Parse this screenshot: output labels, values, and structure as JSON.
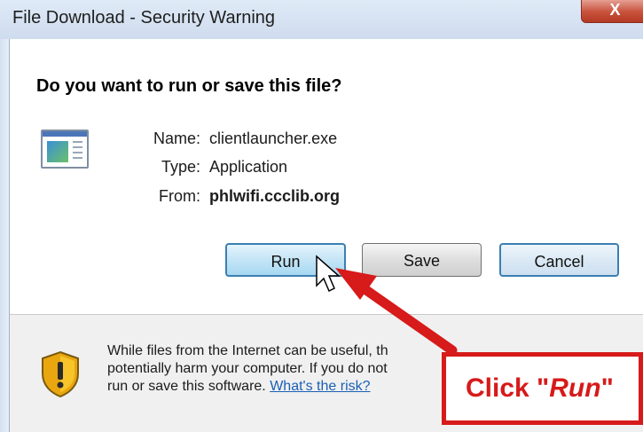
{
  "window": {
    "title": "File Download - Security Warning",
    "close_label": "X"
  },
  "dialog": {
    "question": "Do you want to run or save this file?",
    "file_icon": "application-window-icon",
    "name_label": "Name:",
    "name_value": "clientlauncher.exe",
    "type_label": "Type:",
    "type_value": "Application",
    "from_label": "From:",
    "from_value": "phlwifi.ccclib.org"
  },
  "buttons": {
    "run": "Run",
    "save": "Save",
    "cancel": "Cancel"
  },
  "warning": {
    "icon": "shield-warning-icon",
    "line1": "While files from the Internet can be useful, th",
    "line2": "potentially harm your computer. If you do not",
    "line3_prefix": "run or save this software.",
    "risk_link": "What's the risk?"
  },
  "annotation": {
    "callout_prefix": "Click \"",
    "callout_emphasis": "Run",
    "callout_suffix": "\"",
    "accent_color": "#d71a1a"
  }
}
